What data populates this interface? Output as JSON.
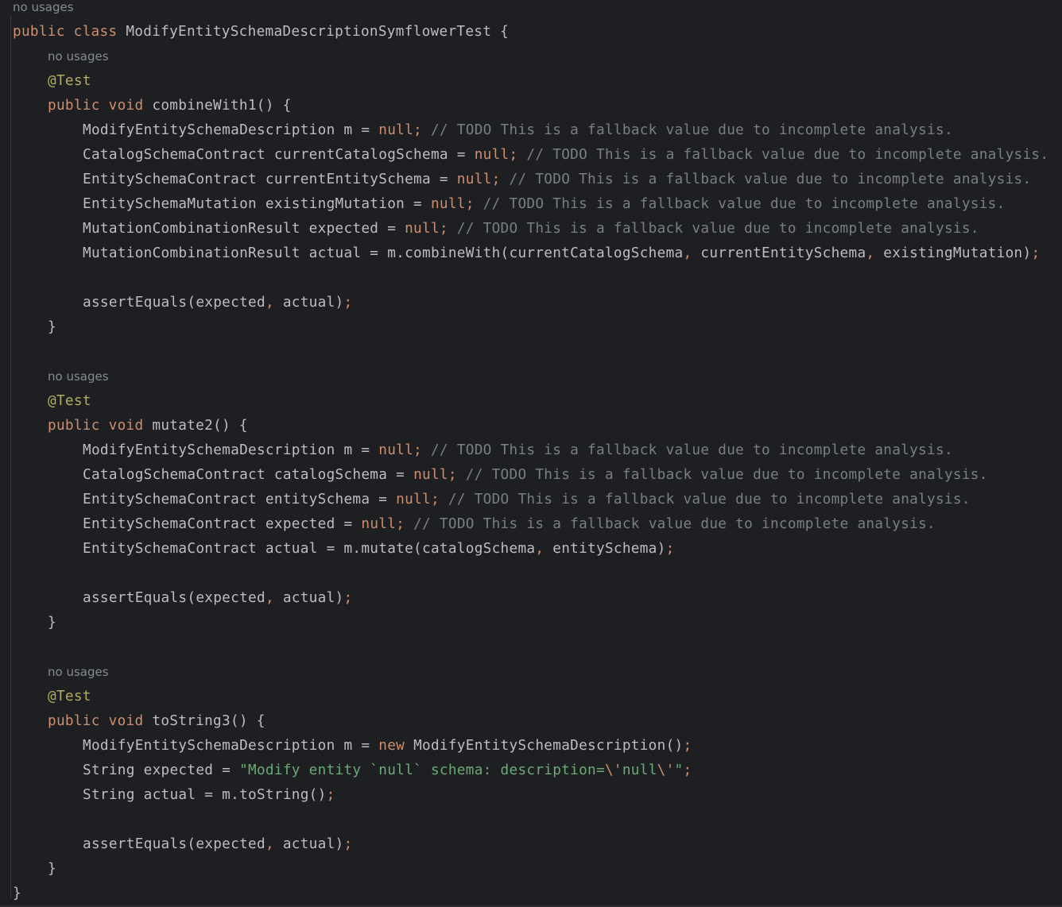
{
  "editor": {
    "language": "java",
    "colors": {
      "background": "#1e1f22",
      "keyword": "#cf8e6d",
      "annotation": "#b3ae60",
      "comment": "#7a7e85",
      "string": "#6aab73",
      "text": "#bcbec4",
      "hint": "#868a91"
    }
  },
  "lines": [
    {
      "indent": 0,
      "hint": true,
      "tokens": [
        [
          "hint",
          "no usages"
        ]
      ]
    },
    {
      "indent": 0,
      "tokens": [
        [
          "kw",
          "public class "
        ],
        [
          "",
          "ModifyEntitySchemaDescriptionSymflowerTest {"
        ]
      ]
    },
    {
      "indent": 1,
      "hint": true,
      "tokens": [
        [
          "hint",
          "no usages"
        ]
      ]
    },
    {
      "indent": 1,
      "tokens": [
        [
          "an",
          "@Test"
        ]
      ]
    },
    {
      "indent": 1,
      "tokens": [
        [
          "kw",
          "public void "
        ],
        [
          "",
          "combineWith1() {"
        ]
      ]
    },
    {
      "indent": 2,
      "tokens": [
        [
          "",
          "ModifyEntitySchemaDescription m = "
        ],
        [
          "kw",
          "null;"
        ],
        [
          "cm",
          " // TODO This is a fallback value due to incomplete analysis."
        ]
      ]
    },
    {
      "indent": 2,
      "tokens": [
        [
          "",
          "CatalogSchemaContract currentCatalogSchema = "
        ],
        [
          "kw",
          "null;"
        ],
        [
          "cm",
          " // TODO This is a fallback value due to incomplete analysis."
        ]
      ]
    },
    {
      "indent": 2,
      "tokens": [
        [
          "",
          "EntitySchemaContract currentEntitySchema = "
        ],
        [
          "kw",
          "null;"
        ],
        [
          "cm",
          " // TODO This is a fallback value due to incomplete analysis."
        ]
      ]
    },
    {
      "indent": 2,
      "tokens": [
        [
          "",
          "EntitySchemaMutation existingMutation = "
        ],
        [
          "kw",
          "null;"
        ],
        [
          "cm",
          " // TODO This is a fallback value due to incomplete analysis."
        ]
      ]
    },
    {
      "indent": 2,
      "tokens": [
        [
          "",
          "MutationCombinationResult expected = "
        ],
        [
          "kw",
          "null;"
        ],
        [
          "cm",
          " // TODO This is a fallback value due to incomplete analysis."
        ]
      ]
    },
    {
      "indent": 2,
      "tokens": [
        [
          "",
          "MutationCombinationResult actual = m.combineWith(currentCatalogSchema"
        ],
        [
          "kw",
          ","
        ],
        [
          "",
          " currentEntitySchema"
        ],
        [
          "kw",
          ","
        ],
        [
          "",
          " existingMutation)"
        ],
        [
          "kw",
          ";"
        ]
      ]
    },
    {
      "indent": 0,
      "tokens": []
    },
    {
      "indent": 2,
      "tokens": [
        [
          "",
          "assertEquals(expected"
        ],
        [
          "kw",
          ","
        ],
        [
          "",
          " actual)"
        ],
        [
          "kw",
          ";"
        ]
      ]
    },
    {
      "indent": 1,
      "tokens": [
        [
          "",
          "}"
        ]
      ]
    },
    {
      "indent": 0,
      "tokens": []
    },
    {
      "indent": 1,
      "hint": true,
      "tokens": [
        [
          "hint",
          "no usages"
        ]
      ]
    },
    {
      "indent": 1,
      "tokens": [
        [
          "an",
          "@Test"
        ]
      ]
    },
    {
      "indent": 1,
      "tokens": [
        [
          "kw",
          "public void "
        ],
        [
          "",
          "mutate2() {"
        ]
      ]
    },
    {
      "indent": 2,
      "tokens": [
        [
          "",
          "ModifyEntitySchemaDescription m = "
        ],
        [
          "kw",
          "null;"
        ],
        [
          "cm",
          " // TODO This is a fallback value due to incomplete analysis."
        ]
      ]
    },
    {
      "indent": 2,
      "tokens": [
        [
          "",
          "CatalogSchemaContract catalogSchema = "
        ],
        [
          "kw",
          "null;"
        ],
        [
          "cm",
          " // TODO This is a fallback value due to incomplete analysis."
        ]
      ]
    },
    {
      "indent": 2,
      "tokens": [
        [
          "",
          "EntitySchemaContract entitySchema = "
        ],
        [
          "kw",
          "null;"
        ],
        [
          "cm",
          " // TODO This is a fallback value due to incomplete analysis."
        ]
      ]
    },
    {
      "indent": 2,
      "tokens": [
        [
          "",
          "EntitySchemaContract expected = "
        ],
        [
          "kw",
          "null;"
        ],
        [
          "cm",
          " // TODO This is a fallback value due to incomplete analysis."
        ]
      ]
    },
    {
      "indent": 2,
      "tokens": [
        [
          "",
          "EntitySchemaContract actual = m.mutate(catalogSchema"
        ],
        [
          "kw",
          ","
        ],
        [
          "",
          " entitySchema)"
        ],
        [
          "kw",
          ";"
        ]
      ]
    },
    {
      "indent": 0,
      "tokens": []
    },
    {
      "indent": 2,
      "tokens": [
        [
          "",
          "assertEquals(expected"
        ],
        [
          "kw",
          ","
        ],
        [
          "",
          " actual)"
        ],
        [
          "kw",
          ";"
        ]
      ]
    },
    {
      "indent": 1,
      "tokens": [
        [
          "",
          "}"
        ]
      ]
    },
    {
      "indent": 0,
      "tokens": []
    },
    {
      "indent": 1,
      "hint": true,
      "tokens": [
        [
          "hint",
          "no usages"
        ]
      ]
    },
    {
      "indent": 1,
      "tokens": [
        [
          "an",
          "@Test"
        ]
      ]
    },
    {
      "indent": 1,
      "tokens": [
        [
          "kw",
          "public void "
        ],
        [
          "",
          "toString3() {"
        ]
      ]
    },
    {
      "indent": 2,
      "tokens": [
        [
          "",
          "ModifyEntitySchemaDescription m = "
        ],
        [
          "kw",
          "new "
        ],
        [
          "",
          "ModifyEntitySchemaDescription()"
        ],
        [
          "kw",
          ";"
        ]
      ]
    },
    {
      "indent": 2,
      "tokens": [
        [
          "",
          "String expected = "
        ],
        [
          "st",
          "\"Modify entity `null` schema: description="
        ],
        [
          "es",
          "\\'"
        ],
        [
          "st",
          "null"
        ],
        [
          "es",
          "\\'"
        ],
        [
          "st",
          "\""
        ],
        [
          "kw",
          ";"
        ]
      ]
    },
    {
      "indent": 2,
      "tokens": [
        [
          "",
          "String actual = m.toString()"
        ],
        [
          "kw",
          ";"
        ]
      ]
    },
    {
      "indent": 0,
      "tokens": []
    },
    {
      "indent": 2,
      "tokens": [
        [
          "",
          "assertEquals(expected"
        ],
        [
          "kw",
          ","
        ],
        [
          "",
          " actual)"
        ],
        [
          "kw",
          ";"
        ]
      ]
    },
    {
      "indent": 1,
      "tokens": [
        [
          "",
          "}"
        ]
      ]
    },
    {
      "indent": 0,
      "tokens": [
        [
          "",
          "}"
        ]
      ]
    }
  ]
}
